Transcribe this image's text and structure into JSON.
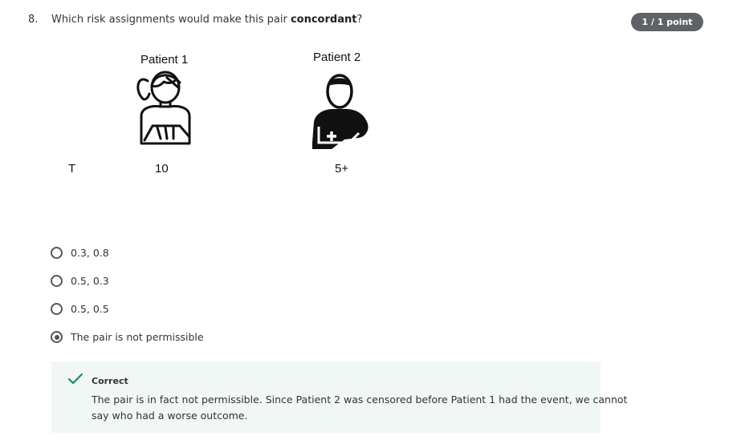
{
  "question": {
    "number": "8.",
    "text_before": "Which risk assignments would make this pair ",
    "text_bold": "concordant",
    "text_after": "?",
    "points": "1 / 1 point"
  },
  "figure": {
    "patient1_label": "Patient 1",
    "patient2_label": "Patient 2",
    "row_label": "T",
    "patient1_value": "10",
    "patient2_value": "5+"
  },
  "options": [
    {
      "label": "0.3, 0.8",
      "selected": false
    },
    {
      "label": "0.5, 0.3",
      "selected": false
    },
    {
      "label": "0.5, 0.5",
      "selected": false
    },
    {
      "label": "The pair is not permissible",
      "selected": true
    }
  ],
  "feedback": {
    "status": "Correct",
    "text": "The pair is in fact not permissible. Since Patient 2 was censored before Patient 1 had the event, we cannot say who had a worse outcome.",
    "color": "#1e8a5a"
  }
}
